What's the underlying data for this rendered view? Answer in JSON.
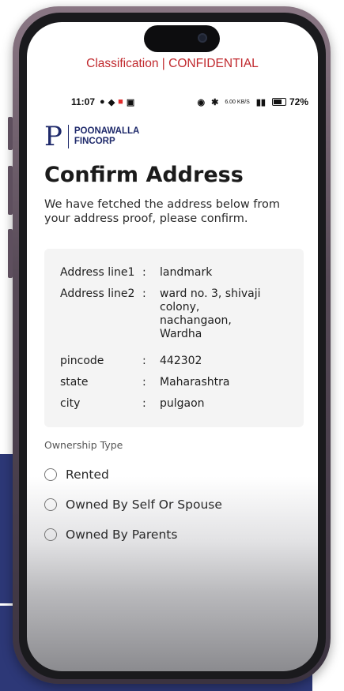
{
  "banner": {
    "classification": "Classification | CONFIDENTIAL"
  },
  "status_bar": {
    "time": "11:07",
    "battery": "72%",
    "network": "6.00 KB/S"
  },
  "brand": {
    "logo_letter": "P",
    "name_line1": "POONAWALLA",
    "name_line2": "FINCORP"
  },
  "page": {
    "title": "Confirm Address",
    "subtitle": "We have fetched the address below from your address proof, please confirm."
  },
  "address": {
    "rows": [
      {
        "label": "Address line1",
        "colon": ":",
        "value": "landmark"
      },
      {
        "label": "Address line2",
        "colon": ":",
        "value": "ward no. 3, shivaji colony, nachangaon, Wardha"
      },
      {
        "label": "pincode",
        "colon": ":",
        "value": "442302"
      },
      {
        "label": "state",
        "colon": ":",
        "value": "Maharashtra"
      },
      {
        "label": "city",
        "colon": ":",
        "value": "pulgaon"
      }
    ]
  },
  "ownership": {
    "label": "Ownership Type",
    "options": [
      {
        "label": "Rented",
        "selected": false
      },
      {
        "label": "Owned By Self Or Spouse",
        "selected": false
      },
      {
        "label": "Owned By Parents",
        "selected": false
      }
    ]
  },
  "colors": {
    "brand_navy": "#2d3877",
    "confidential_red": "#c0282d",
    "text_dark": "#1b1b1b"
  }
}
